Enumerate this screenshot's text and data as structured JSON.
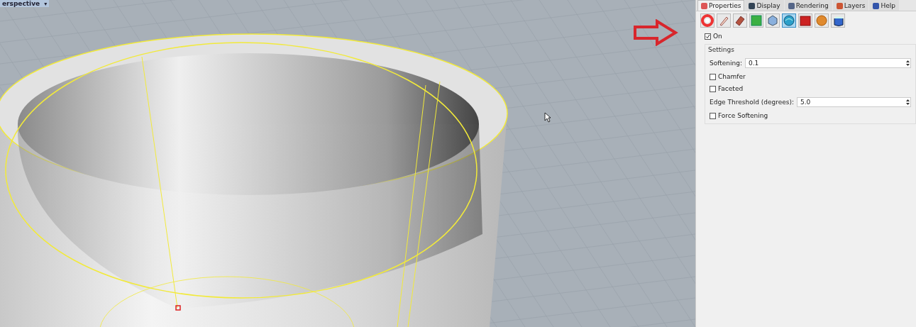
{
  "viewport": {
    "title": "erspective",
    "caret": "▾"
  },
  "panel": {
    "tabs": [
      {
        "label": "Properties",
        "selected": true
      },
      {
        "label": "Display",
        "selected": false
      },
      {
        "label": "Rendering",
        "selected": false
      },
      {
        "label": "Layers",
        "selected": false
      },
      {
        "label": "Help",
        "selected": false
      }
    ],
    "toolbar": [
      {
        "selected": false
      },
      {
        "selected": false
      },
      {
        "selected": false
      },
      {
        "selected": false
      },
      {
        "selected": false
      },
      {
        "selected": true
      },
      {
        "selected": false
      },
      {
        "selected": false
      },
      {
        "selected": false
      }
    ],
    "on": {
      "label": "On",
      "checked": true
    },
    "settings": {
      "title": "Settings",
      "rows": [
        {
          "kind": "field",
          "label": "Softening:",
          "value": "0.1"
        },
        {
          "kind": "checkbox",
          "label": "Chamfer",
          "checked": false
        },
        {
          "kind": "checkbox",
          "label": "Faceted",
          "checked": false
        },
        {
          "kind": "field",
          "label": "Edge Threshold (degrees):",
          "value": "5.0"
        },
        {
          "kind": "checkbox",
          "label": "Force Softening",
          "checked": false
        }
      ]
    }
  }
}
